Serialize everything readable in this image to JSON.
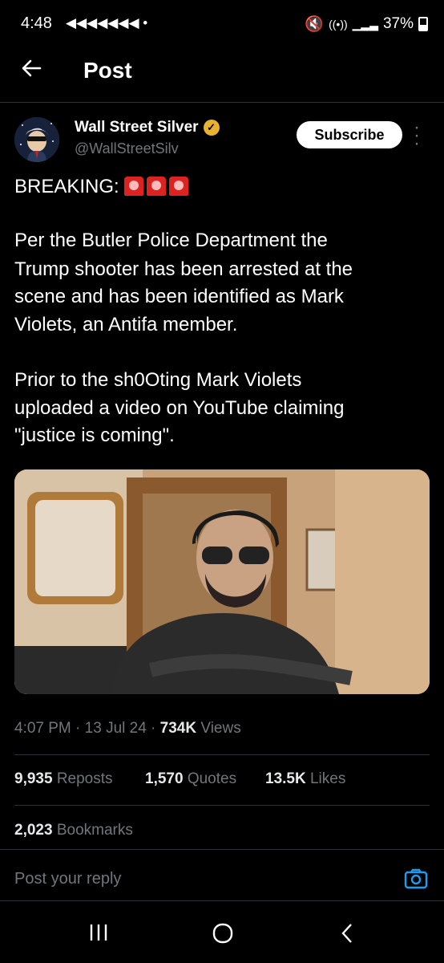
{
  "status_bar": {
    "time": "4:48",
    "notifications": "◀◀◀◀◀◀◀ •",
    "battery": "37%"
  },
  "header": {
    "title": "Post"
  },
  "author": {
    "name": "Wall Street Silver",
    "handle": "@WallStreetSilv",
    "subscribe_label": "Subscribe"
  },
  "post": {
    "line1": "BREAKING:",
    "paragraph1": [
      "Per the Butler Police Department the",
      "Trump shooter has been arrested at the",
      "scene and has been identified as Mark",
      "Violets, an Antifa member."
    ],
    "paragraph2": [
      "Prior to the sh0Oting Mark Violets",
      "uploaded a video on YouTube claiming",
      "\"justice is coming\"."
    ]
  },
  "meta": {
    "time": "4:07 PM",
    "date": "13 Jul 24",
    "views_count": "734K",
    "views_label": "Views"
  },
  "stats": {
    "reposts_count": "9,935",
    "reposts_label": "Reposts",
    "quotes_count": "1,570",
    "quotes_label": "Quotes",
    "likes_count": "13.5K",
    "likes_label": "Likes",
    "bookmarks_count": "2,023",
    "bookmarks_label": "Bookmarks"
  },
  "reply": {
    "placeholder": "Post your reply"
  },
  "colors": {
    "background": "#000000",
    "link": "#1d9bf0",
    "muted": "#71767b"
  }
}
